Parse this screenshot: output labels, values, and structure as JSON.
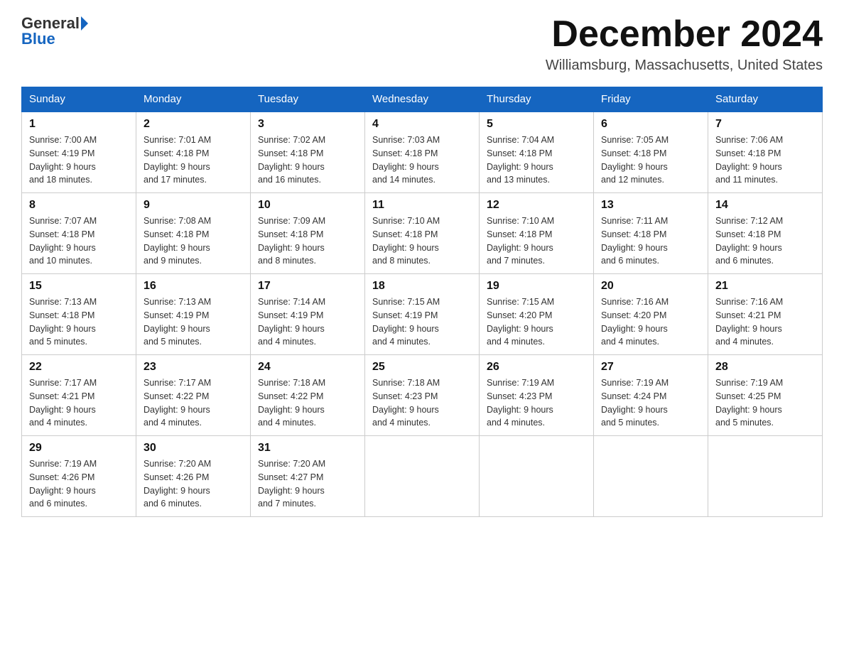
{
  "header": {
    "logo_general": "General",
    "logo_blue": "Blue",
    "month_title": "December 2024",
    "location": "Williamsburg, Massachusetts, United States"
  },
  "days_of_week": [
    "Sunday",
    "Monday",
    "Tuesday",
    "Wednesday",
    "Thursday",
    "Friday",
    "Saturday"
  ],
  "weeks": [
    [
      {
        "day": "1",
        "sunrise": "7:00 AM",
        "sunset": "4:19 PM",
        "daylight": "9 hours and 18 minutes."
      },
      {
        "day": "2",
        "sunrise": "7:01 AM",
        "sunset": "4:18 PM",
        "daylight": "9 hours and 17 minutes."
      },
      {
        "day": "3",
        "sunrise": "7:02 AM",
        "sunset": "4:18 PM",
        "daylight": "9 hours and 16 minutes."
      },
      {
        "day": "4",
        "sunrise": "7:03 AM",
        "sunset": "4:18 PM",
        "daylight": "9 hours and 14 minutes."
      },
      {
        "day": "5",
        "sunrise": "7:04 AM",
        "sunset": "4:18 PM",
        "daylight": "9 hours and 13 minutes."
      },
      {
        "day": "6",
        "sunrise": "7:05 AM",
        "sunset": "4:18 PM",
        "daylight": "9 hours and 12 minutes."
      },
      {
        "day": "7",
        "sunrise": "7:06 AM",
        "sunset": "4:18 PM",
        "daylight": "9 hours and 11 minutes."
      }
    ],
    [
      {
        "day": "8",
        "sunrise": "7:07 AM",
        "sunset": "4:18 PM",
        "daylight": "9 hours and 10 minutes."
      },
      {
        "day": "9",
        "sunrise": "7:08 AM",
        "sunset": "4:18 PM",
        "daylight": "9 hours and 9 minutes."
      },
      {
        "day": "10",
        "sunrise": "7:09 AM",
        "sunset": "4:18 PM",
        "daylight": "9 hours and 8 minutes."
      },
      {
        "day": "11",
        "sunrise": "7:10 AM",
        "sunset": "4:18 PM",
        "daylight": "9 hours and 8 minutes."
      },
      {
        "day": "12",
        "sunrise": "7:10 AM",
        "sunset": "4:18 PM",
        "daylight": "9 hours and 7 minutes."
      },
      {
        "day": "13",
        "sunrise": "7:11 AM",
        "sunset": "4:18 PM",
        "daylight": "9 hours and 6 minutes."
      },
      {
        "day": "14",
        "sunrise": "7:12 AM",
        "sunset": "4:18 PM",
        "daylight": "9 hours and 6 minutes."
      }
    ],
    [
      {
        "day": "15",
        "sunrise": "7:13 AM",
        "sunset": "4:18 PM",
        "daylight": "9 hours and 5 minutes."
      },
      {
        "day": "16",
        "sunrise": "7:13 AM",
        "sunset": "4:19 PM",
        "daylight": "9 hours and 5 minutes."
      },
      {
        "day": "17",
        "sunrise": "7:14 AM",
        "sunset": "4:19 PM",
        "daylight": "9 hours and 4 minutes."
      },
      {
        "day": "18",
        "sunrise": "7:15 AM",
        "sunset": "4:19 PM",
        "daylight": "9 hours and 4 minutes."
      },
      {
        "day": "19",
        "sunrise": "7:15 AM",
        "sunset": "4:20 PM",
        "daylight": "9 hours and 4 minutes."
      },
      {
        "day": "20",
        "sunrise": "7:16 AM",
        "sunset": "4:20 PM",
        "daylight": "9 hours and 4 minutes."
      },
      {
        "day": "21",
        "sunrise": "7:16 AM",
        "sunset": "4:21 PM",
        "daylight": "9 hours and 4 minutes."
      }
    ],
    [
      {
        "day": "22",
        "sunrise": "7:17 AM",
        "sunset": "4:21 PM",
        "daylight": "9 hours and 4 minutes."
      },
      {
        "day": "23",
        "sunrise": "7:17 AM",
        "sunset": "4:22 PM",
        "daylight": "9 hours and 4 minutes."
      },
      {
        "day": "24",
        "sunrise": "7:18 AM",
        "sunset": "4:22 PM",
        "daylight": "9 hours and 4 minutes."
      },
      {
        "day": "25",
        "sunrise": "7:18 AM",
        "sunset": "4:23 PM",
        "daylight": "9 hours and 4 minutes."
      },
      {
        "day": "26",
        "sunrise": "7:19 AM",
        "sunset": "4:23 PM",
        "daylight": "9 hours and 4 minutes."
      },
      {
        "day": "27",
        "sunrise": "7:19 AM",
        "sunset": "4:24 PM",
        "daylight": "9 hours and 5 minutes."
      },
      {
        "day": "28",
        "sunrise": "7:19 AM",
        "sunset": "4:25 PM",
        "daylight": "9 hours and 5 minutes."
      }
    ],
    [
      {
        "day": "29",
        "sunrise": "7:19 AM",
        "sunset": "4:26 PM",
        "daylight": "9 hours and 6 minutes."
      },
      {
        "day": "30",
        "sunrise": "7:20 AM",
        "sunset": "4:26 PM",
        "daylight": "9 hours and 6 minutes."
      },
      {
        "day": "31",
        "sunrise": "7:20 AM",
        "sunset": "4:27 PM",
        "daylight": "9 hours and 7 minutes."
      },
      null,
      null,
      null,
      null
    ]
  ],
  "labels": {
    "sunrise": "Sunrise:",
    "sunset": "Sunset:",
    "daylight": "Daylight:"
  }
}
